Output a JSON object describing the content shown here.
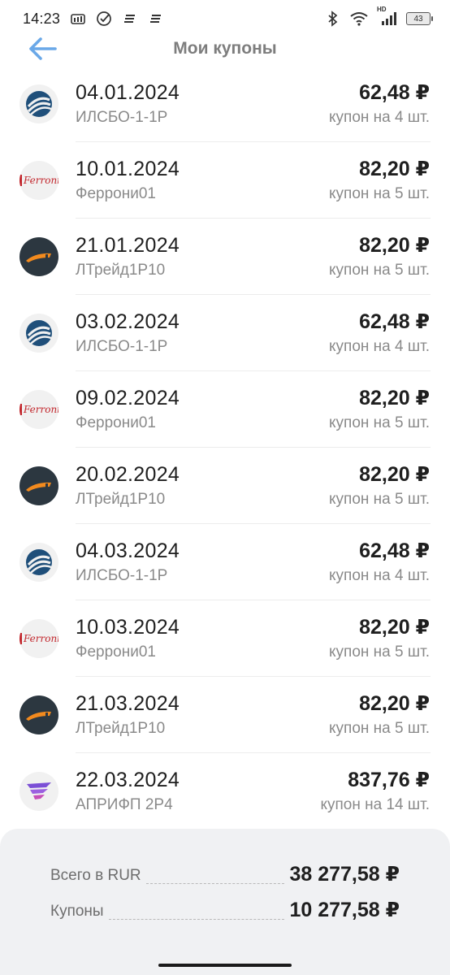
{
  "status_bar": {
    "time": "14:23",
    "network_label": "HD",
    "battery": "43"
  },
  "header": {
    "title": "Мои купоны"
  },
  "coupons": [
    {
      "date": "04.01.2024",
      "name": "ИЛСБО-1-1Р",
      "amount": "62,48 ₽",
      "qty": "купон на 4 шт.",
      "logo": "ilsbo-logo"
    },
    {
      "date": "10.01.2024",
      "name": "Феррони01",
      "amount": "82,20 ₽",
      "qty": "купон на 5 шт.",
      "logo": "ferroni-logo",
      "logo_text": "Ferroni"
    },
    {
      "date": "21.01.2024",
      "name": "ЛТрейд1Р10",
      "amount": "82,20 ₽",
      "qty": "купон на 5 шт.",
      "logo": "ltrade-logo"
    },
    {
      "date": "03.02.2024",
      "name": "ИЛСБО-1-1Р",
      "amount": "62,48 ₽",
      "qty": "купон на 4 шт.",
      "logo": "ilsbo-logo"
    },
    {
      "date": "09.02.2024",
      "name": "Феррони01",
      "amount": "82,20 ₽",
      "qty": "купон на 5 шт.",
      "logo": "ferroni-logo",
      "logo_text": "Ferroni"
    },
    {
      "date": "20.02.2024",
      "name": "ЛТрейд1Р10",
      "amount": "82,20 ₽",
      "qty": "купон на 5 шт.",
      "logo": "ltrade-logo"
    },
    {
      "date": "04.03.2024",
      "name": "ИЛСБО-1-1Р",
      "amount": "62,48 ₽",
      "qty": "купон на 4 шт.",
      "logo": "ilsbo-logo"
    },
    {
      "date": "10.03.2024",
      "name": "Феррони01",
      "amount": "82,20 ₽",
      "qty": "купон на 5 шт.",
      "logo": "ferroni-logo",
      "logo_text": "Ferroni"
    },
    {
      "date": "21.03.2024",
      "name": "ЛТрейд1Р10",
      "amount": "82,20 ₽",
      "qty": "купон на 5 шт.",
      "logo": "ltrade-logo"
    },
    {
      "date": "22.03.2024",
      "name": "АПРИФП 2Р4",
      "amount": "837,76 ₽",
      "qty": "купон на 14 шт.",
      "logo": "aprifp-logo"
    }
  ],
  "summary": {
    "total_label": "Всего в RUR",
    "total_value": "38 277,58 ₽",
    "coupons_label": "Купоны",
    "coupons_value": "10 277,58 ₽"
  },
  "colors": {
    "accent": "#6aa8e8",
    "ilsbo_blue": "#1f4f7a",
    "ltrade_orange": "#f28a1e",
    "ltrade_bg": "#2c3740",
    "ferroni_red": "#c2272d",
    "aprifp_purple": "#7b4fd6"
  }
}
